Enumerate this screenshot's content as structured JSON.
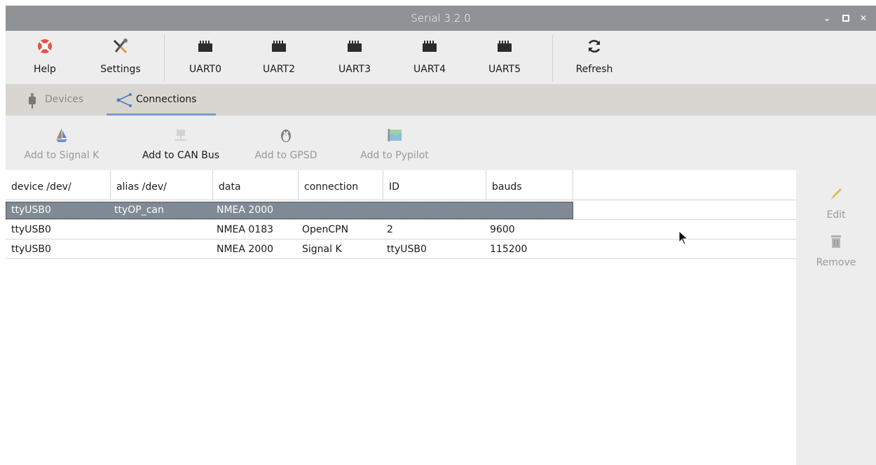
{
  "window": {
    "title": "Serial 3.2.0"
  },
  "toolbar": {
    "help_label": "Help",
    "settings_label": "Settings",
    "uart0_label": "UART0",
    "uart2_label": "UART2",
    "uart3_label": "UART3",
    "uart4_label": "UART4",
    "uart5_label": "UART5",
    "refresh_label": "Refresh"
  },
  "tabs": {
    "devices_label": "Devices",
    "connections_label": "Connections",
    "active": "Connections"
  },
  "actions": {
    "signalk_label": "Add to Signal K",
    "canbus_label": "Add to CAN Bus",
    "gpsd_label": "Add to GPSD",
    "pypilot_label": "Add to Pypilot"
  },
  "table": {
    "columns": [
      "device /dev/",
      "alias /dev/",
      "data",
      "connection",
      "ID",
      "bauds"
    ],
    "rows": [
      {
        "device": "ttyUSB0",
        "alias": "ttyOP_can",
        "data": "NMEA 2000",
        "connection": "",
        "id": "",
        "bauds": ""
      },
      {
        "device": "ttyUSB0",
        "alias": "",
        "data": "NMEA 0183",
        "connection": "OpenCPN",
        "id": "2",
        "bauds": "9600"
      },
      {
        "device": "ttyUSB0",
        "alias": "",
        "data": "NMEA 2000",
        "connection": "Signal K",
        "id": "ttyUSB0",
        "bauds": "115200"
      }
    ],
    "selected_row": 0
  },
  "side": {
    "edit_label": "Edit",
    "remove_label": "Remove"
  },
  "colors": {
    "titlebar": "#8f9396",
    "selection": "#7f8a94",
    "tab_underline": "#7a9cc6"
  }
}
